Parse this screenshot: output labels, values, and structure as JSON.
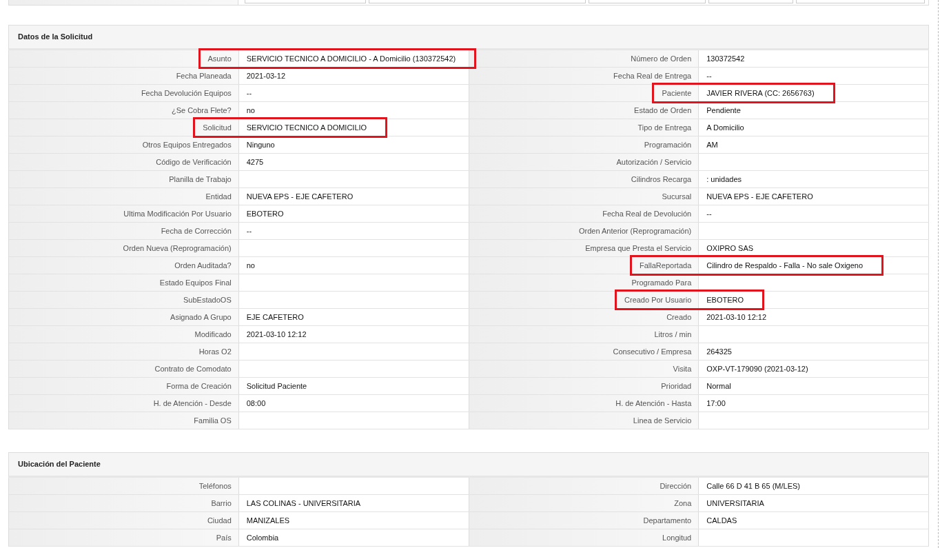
{
  "sections": [
    {
      "title": "Datos de la Solicitud",
      "fields": [
        {
          "label": "Asunto",
          "value": "SERVICIO TECNICO A DOMICILIO - A Domicilio (130372542)",
          "highlighted": true
        },
        {
          "label": "Número de Orden",
          "value": "130372542",
          "highlighted": false
        },
        {
          "label": "Fecha Planeada",
          "value": "2021-03-12",
          "highlighted": false
        },
        {
          "label": "Fecha Real de Entrega",
          "value": "--",
          "highlighted": false
        },
        {
          "label": "Fecha Devolución Equipos",
          "value": "--",
          "highlighted": false
        },
        {
          "label": "Paciente",
          "value": "JAVIER RIVERA (CC: 2656763)",
          "highlighted": true
        },
        {
          "label": "¿Se Cobra Flete?",
          "value": "no",
          "highlighted": false
        },
        {
          "label": "Estado de Orden",
          "value": "Pendiente",
          "highlighted": false
        },
        {
          "label": "Solicitud",
          "value": "SERVICIO TECNICO A DOMICILIO",
          "highlighted": true
        },
        {
          "label": "Tipo de Entrega",
          "value": "A Domicilio",
          "highlighted": false
        },
        {
          "label": "Otros Equipos Entregados",
          "value": "Ninguno",
          "highlighted": false
        },
        {
          "label": "Programación",
          "value": "AM",
          "highlighted": false
        },
        {
          "label": "Código de Verificación",
          "value": "4275",
          "highlighted": false
        },
        {
          "label": "Autorización / Servicio",
          "highlighted": false
        },
        {
          "label": "Planilla de Trabajo",
          "highlighted": false
        },
        {
          "label": "Cilindros Recarga",
          "value": ": unidades",
          "highlighted": false
        },
        {
          "label": "Entidad",
          "value": "NUEVA EPS - EJE CAFETERO",
          "highlighted": false
        },
        {
          "label": "Sucursal",
          "value": "NUEVA EPS - EJE CAFETERO",
          "highlighted": false
        },
        {
          "label": "Ultima Modificación Por Usuario",
          "value": "EBOTERO",
          "highlighted": false
        },
        {
          "label": "Fecha Real de Devolución",
          "value": "--",
          "highlighted": false
        },
        {
          "label": "Fecha de Corrección",
          "value": "--",
          "highlighted": false
        },
        {
          "label": "Orden Anterior (Reprogramación)",
          "highlighted": false
        },
        {
          "label": "Orden Nueva (Reprogramación)",
          "highlighted": false
        },
        {
          "label": "Empresa que Presta el Servicio",
          "value": "OXIPRO SAS",
          "highlighted": false
        },
        {
          "label": "Orden Auditada?",
          "value": "no",
          "highlighted": false
        },
        {
          "label": "FallaReportada",
          "value": "Cilindro de Respaldo - Falla - No sale Oxigeno",
          "highlighted": true
        },
        {
          "label": "Estado Equipos Final",
          "highlighted": false
        },
        {
          "label": "Programado Para",
          "highlighted": false
        },
        {
          "label": "SubEstadoOS",
          "highlighted": false
        },
        {
          "label": "Creado Por Usuario",
          "value": "EBOTERO",
          "highlighted": true
        },
        {
          "label": "Asignado A Grupo",
          "value": "EJE CAFETERO",
          "highlighted": false
        },
        {
          "label": "Creado",
          "value": "2021-03-10 12:12",
          "highlighted": false
        },
        {
          "label": "Modificado",
          "value": "2021-03-10 12:12",
          "highlighted": false
        },
        {
          "label": "Litros / min",
          "highlighted": false
        },
        {
          "label": "Horas O2",
          "highlighted": false
        },
        {
          "label": "Consecutivo / Empresa",
          "value": "264325",
          "highlighted": false
        },
        {
          "label": "Contrato de Comodato",
          "highlighted": false
        },
        {
          "label": "Visita",
          "value": "OXP-VT-179090 (2021-03-12)",
          "highlighted": false
        },
        {
          "label": "Forma de Creación",
          "value": "Solicitud Paciente",
          "highlighted": false
        },
        {
          "label": "Prioridad",
          "value": "Normal",
          "highlighted": false
        },
        {
          "label": "H. de Atención - Desde",
          "value": "08:00",
          "highlighted": false
        },
        {
          "label": "H. de Atención - Hasta",
          "value": "17:00",
          "highlighted": false
        },
        {
          "label": "Familia OS",
          "highlighted": false
        },
        {
          "label": "Linea de Servicio",
          "highlighted": false
        }
      ]
    },
    {
      "title": "Ubicación del Paciente",
      "fields": [
        {
          "label": "Teléfonos",
          "highlighted": false
        },
        {
          "label": "Dirección",
          "value": "Calle 66 D 41 B 65 (M/LES)",
          "highlighted": false
        },
        {
          "label": "Barrio",
          "value": "LAS COLINAS - UNIVERSITARIA",
          "highlighted": false
        },
        {
          "label": "Zona",
          "value": "UNIVERSITARIA",
          "highlighted": false
        },
        {
          "label": "Ciudad",
          "value": "MANIZALES",
          "highlighted": false
        },
        {
          "label": "Departamento",
          "value": "CALDAS",
          "highlighted": false
        },
        {
          "label": "País",
          "value": "Colombia",
          "highlighted": false
        },
        {
          "label": "Longitud",
          "highlighted": false
        }
      ]
    }
  ]
}
